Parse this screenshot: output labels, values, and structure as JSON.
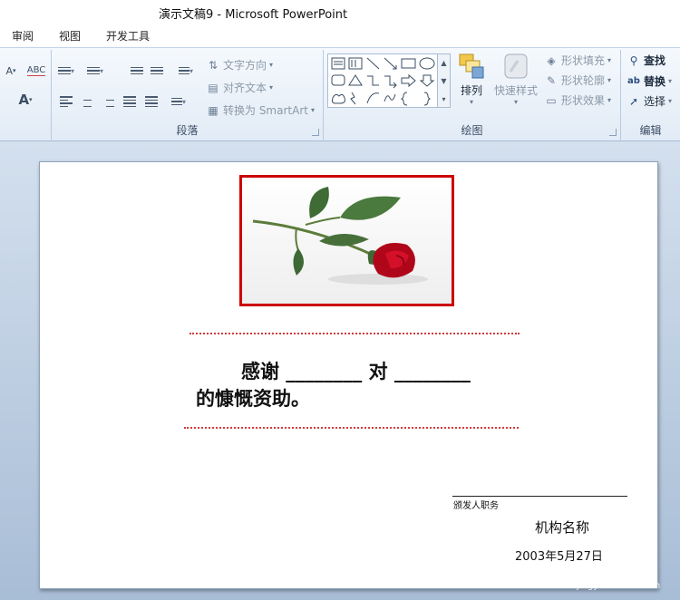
{
  "window": {
    "title": "演示文稿9 - Microsoft PowerPoint"
  },
  "menu": {
    "tabs": [
      "审阅",
      "视图",
      "开发工具"
    ]
  },
  "ribbon": {
    "paragraph": {
      "label": "段落",
      "text_direction": "文字方向",
      "align_text": "对齐文本",
      "convert_smartart": "转换为 SmartArt"
    },
    "drawing": {
      "label": "绘图",
      "arrange": "排列",
      "quick_styles": "快速样式",
      "shape_fill": "形状填充",
      "shape_outline": "形状轮廓",
      "shape_effects": "形状效果"
    },
    "editing": {
      "label": "编辑",
      "find": "查找",
      "replace": "替换",
      "select": "选择"
    }
  },
  "slide": {
    "line1": "感谢 ________ 对 ________",
    "line2": "的慷慨资助。",
    "signature_label": "颁发人职务",
    "org_name": "机构名称",
    "date": "2003年5月27日"
  },
  "watermark": {
    "brand": "Baidu 经验",
    "url": "jingyan.baidu.com"
  },
  "colors": {
    "frame": "#cc0000",
    "dotted": "#d13a3a",
    "ribbon_bg": "#e2ebf6"
  }
}
